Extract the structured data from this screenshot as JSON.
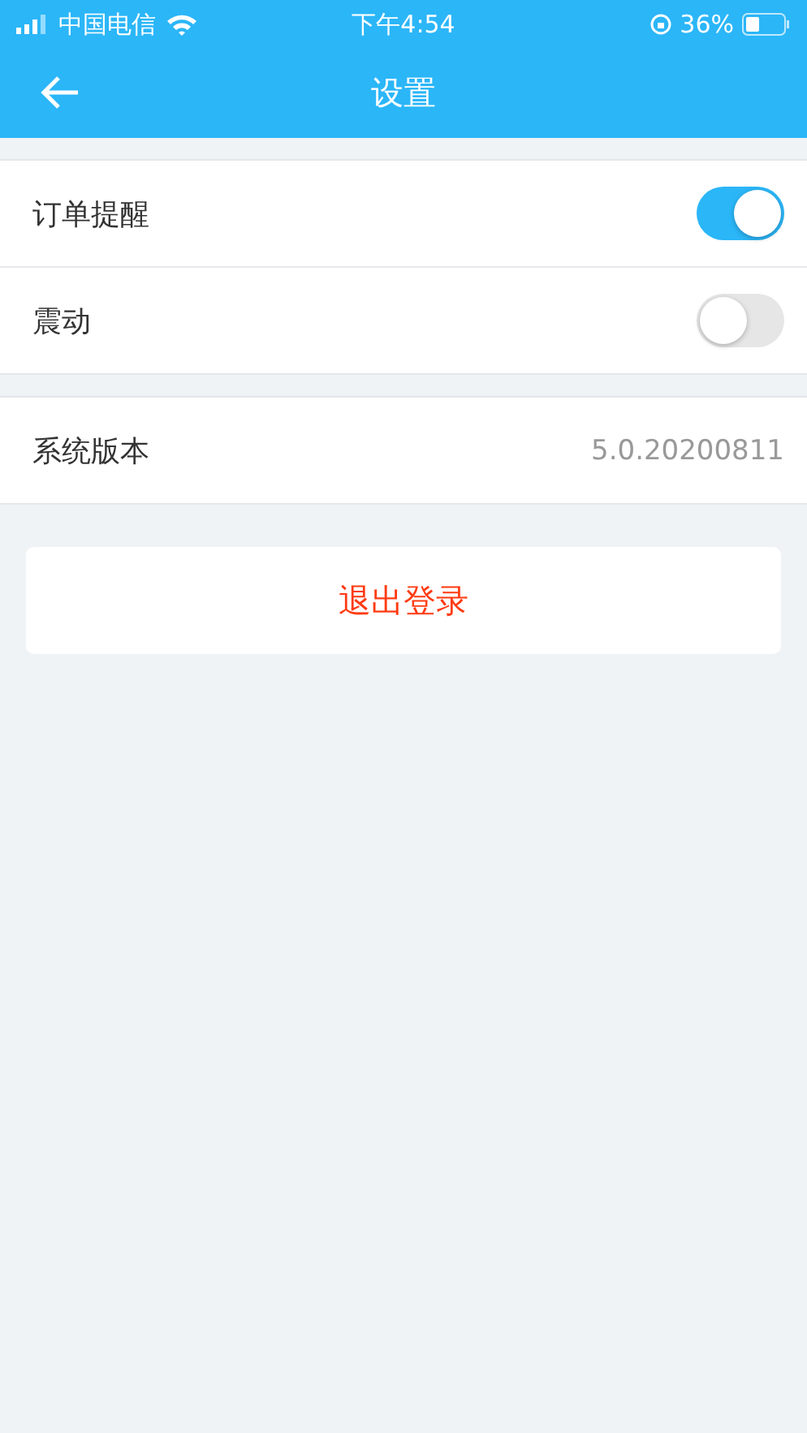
{
  "status_bar": {
    "carrier": "中国电信",
    "time": "下午4:54",
    "battery": "36%"
  },
  "header": {
    "title": "设置"
  },
  "toggles": [
    {
      "label": "订单提醒",
      "on": true
    },
    {
      "label": "震动",
      "on": false
    }
  ],
  "info": {
    "label": "系统版本",
    "value": "5.0.20200811"
  },
  "logout": {
    "label": "退出登录"
  }
}
